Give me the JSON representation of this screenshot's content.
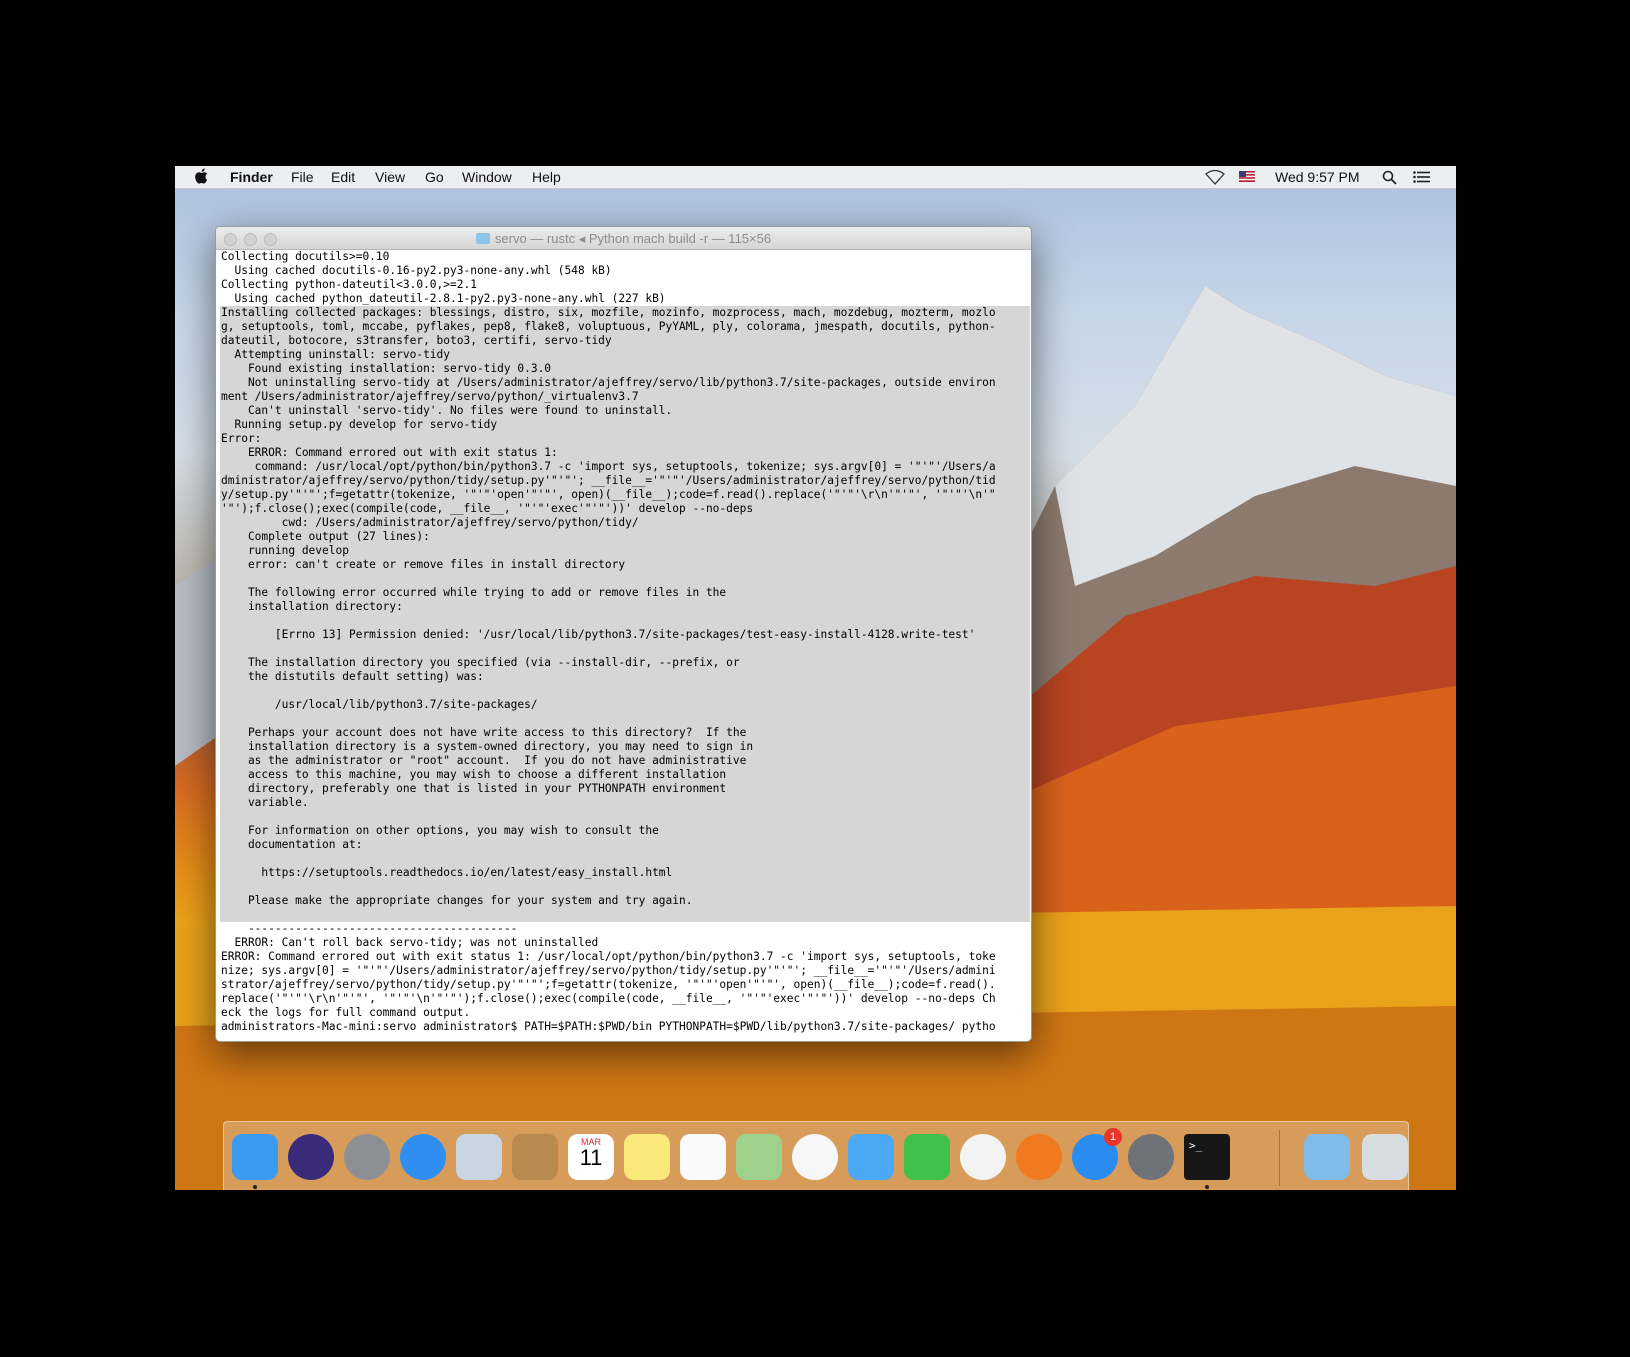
{
  "menubar": {
    "app": "Finder",
    "menus": [
      "File",
      "Edit",
      "View",
      "Go",
      "Window",
      "Help"
    ],
    "clock": "Wed 9:57 PM",
    "icons": [
      "apple-icon",
      "wifi-icon",
      "flag-icon",
      "spotlight-icon",
      "notification-center-icon"
    ]
  },
  "terminal": {
    "title": "servo — rustc ◂ Python mach build -r — 115×56",
    "lines": [
      "Collecting docutils>=0.10",
      "  Using cached docutils-0.16-py2.py3-none-any.whl (548 kB)",
      "Collecting python-dateutil<3.0.0,>=2.1",
      "  Using cached python_dateutil-2.8.1-py2.py3-none-any.whl (227 kB)",
      "Installing collected packages: blessings, distro, six, mozfile, mozinfo, mozprocess, mach, mozdebug, mozterm, mozlo",
      "g, setuptools, toml, mccabe, pyflakes, pep8, flake8, voluptuous, PyYAML, ply, colorama, jmespath, docutils, python-",
      "dateutil, botocore, s3transfer, boto3, certifi, servo-tidy",
      "  Attempting uninstall: servo-tidy",
      "    Found existing installation: servo-tidy 0.3.0",
      "    Not uninstalling servo-tidy at /Users/administrator/ajeffrey/servo/lib/python3.7/site-packages, outside environ",
      "ment /Users/administrator/ajeffrey/servo/python/_virtualenv3.7",
      "    Can't uninstall 'servo-tidy'. No files were found to uninstall.",
      "  Running setup.py develop for servo-tidy",
      "Error:",
      "    ERROR: Command errored out with exit status 1:",
      "     command: /usr/local/opt/python/bin/python3.7 -c 'import sys, setuptools, tokenize; sys.argv[0] = '\"'\"'/Users/a",
      "dministrator/ajeffrey/servo/python/tidy/setup.py'\"'\"'; __file__='\"'\"'/Users/administrator/ajeffrey/servo/python/tid",
      "y/setup.py'\"'\"';f=getattr(tokenize, '\"'\"'open'\"'\"', open)(__file__);code=f.read().replace('\"'\"'\\r\\n'\"'\"', '\"'\"'\\n'\"",
      "'\"');f.close();exec(compile(code, __file__, '\"'\"'exec'\"'\"'))' develop --no-deps",
      "         cwd: /Users/administrator/ajeffrey/servo/python/tidy/",
      "    Complete output (27 lines):",
      "    running develop",
      "    error: can't create or remove files in install directory",
      "",
      "    The following error occurred while trying to add or remove files in the",
      "    installation directory:",
      "",
      "        [Errno 13] Permission denied: '/usr/local/lib/python3.7/site-packages/test-easy-install-4128.write-test'",
      "",
      "    The installation directory you specified (via --install-dir, --prefix, or",
      "    the distutils default setting) was:",
      "",
      "        /usr/local/lib/python3.7/site-packages/",
      "",
      "    Perhaps your account does not have write access to this directory?  If the",
      "    installation directory is a system-owned directory, you may need to sign in",
      "    as the administrator or \"root\" account.  If you do not have administrative",
      "    access to this machine, you may wish to choose a different installation",
      "    directory, preferably one that is listed in your PYTHONPATH environment",
      "    variable.",
      "",
      "    For information on other options, you may wish to consult the",
      "    documentation at:",
      "",
      "      https://setuptools.readthedocs.io/en/latest/easy_install.html",
      "",
      "    Please make the appropriate changes for your system and try again.",
      "",
      "    ----------------------------------------",
      "  ERROR: Can't roll back servo-tidy; was not uninstalled",
      "ERROR: Command errored out with exit status 1: /usr/local/opt/python/bin/python3.7 -c 'import sys, setuptools, toke",
      "nize; sys.argv[0] = '\"'\"'/Users/administrator/ajeffrey/servo/python/tidy/setup.py'\"'\"'; __file__='\"'\"'/Users/admini",
      "strator/ajeffrey/servo/python/tidy/setup.py'\"'\"';f=getattr(tokenize, '\"'\"'open'\"'\"', open)(__file__);code=f.read().",
      "replace('\"'\"'\\r\\n'\"'\"', '\"'\"'\\n'\"'\"');f.close();exec(compile(code, __file__, '\"'\"'exec'\"'\"'))' develop --no-deps Ch",
      "eck the logs for full command output.",
      "administrators-Mac-mini:servo administrator$ PATH=$PATH:$PWD/bin PYTHONPATH=$PWD/lib/python3.7/site-packages/ pytho"
    ],
    "selected_from": 4,
    "selected_to": 47
  },
  "dock": {
    "apps": [
      {
        "name": "finder-icon",
        "color": "#3b9bf0",
        "running": true
      },
      {
        "name": "siri-icon",
        "color": "#3a2a7a",
        "running": false
      },
      {
        "name": "launchpad-icon",
        "color": "#8d8f93",
        "running": false
      },
      {
        "name": "safari-icon",
        "color": "#2f8ef0",
        "running": false
      },
      {
        "name": "mail-icon",
        "color": "#c9d6e2",
        "running": false
      },
      {
        "name": "contacts-icon",
        "color": "#b88a4e",
        "running": false
      },
      {
        "name": "calendar-icon",
        "color": "#ffffff",
        "running": false
      },
      {
        "name": "notes-icon",
        "color": "#fbe87a",
        "running": false
      },
      {
        "name": "reminders-icon",
        "color": "#fafafa",
        "running": false
      },
      {
        "name": "maps-icon",
        "color": "#9ed28c",
        "running": false
      },
      {
        "name": "photos-icon",
        "color": "#f7f7f7",
        "running": false
      },
      {
        "name": "messages-icon",
        "color": "#4aa8f5",
        "running": false
      },
      {
        "name": "facetime-icon",
        "color": "#3fc24c",
        "running": false
      },
      {
        "name": "itunes-icon",
        "color": "#f3f3f3",
        "running": false
      },
      {
        "name": "ibooks-icon",
        "color": "#f07a20",
        "running": false
      },
      {
        "name": "app-store-icon",
        "color": "#2a8cf0",
        "running": false,
        "badge": "1"
      },
      {
        "name": "system-preferences-icon",
        "color": "#6f7277",
        "running": false
      },
      {
        "name": "terminal-icon",
        "color": "#161616",
        "running": true
      }
    ],
    "right": [
      {
        "name": "downloads-icon",
        "color": "#7fbde8"
      },
      {
        "name": "trash-icon",
        "color": "#d8dde2"
      }
    ],
    "calendar_month": "MAR",
    "calendar_day": "11",
    "terminal_glyph": ">_"
  }
}
